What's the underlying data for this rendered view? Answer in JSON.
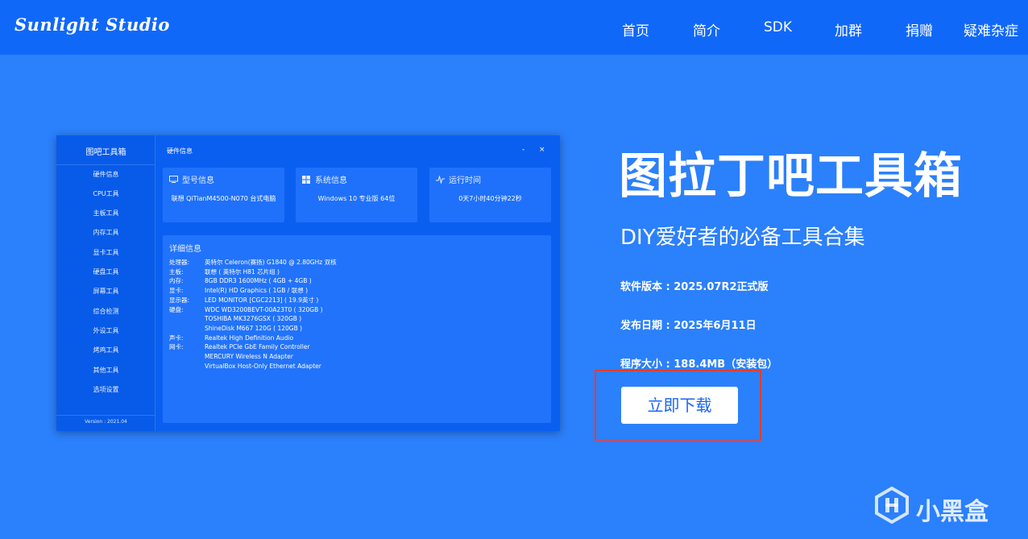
{
  "header": {
    "logo": "Sunlight Studio",
    "nav": [
      "首页",
      "简介",
      "SDK",
      "加群",
      "捐赠",
      "疑难杂症"
    ]
  },
  "app": {
    "sidebar_title": "图吧工具箱",
    "sidebar_items": [
      "硬件信息",
      "CPU工具",
      "主板工具",
      "内存工具",
      "显卡工具",
      "硬盘工具",
      "屏幕工具",
      "综合检测",
      "外设工具",
      "烤鸡工具",
      "其他工具",
      "选项设置"
    ],
    "version": "Version : 2021.04",
    "window_title": "硬件信息",
    "minimize": "-",
    "close": "×",
    "cards": [
      {
        "title": "型号信息",
        "value": "联想 QiTianM4500-N070 台式电脑",
        "icon": "monitor-icon"
      },
      {
        "title": "系统信息",
        "value": "Windows 10 专业版 64位",
        "icon": "windows-icon"
      },
      {
        "title": "运行时间",
        "value": "0天7小时40分钟22秒",
        "icon": "pulse-icon"
      }
    ],
    "details_title": "详细信息",
    "details": [
      {
        "k": "处理器:",
        "v": "英特尔 Celeron(赛扬) G1840 @ 2.80GHz 双核"
      },
      {
        "k": "主板:",
        "v": "联想 ( 英特尔 H81 芯片组 )"
      },
      {
        "k": "内存:",
        "v": "8GB DDR3 1600MHz ( 4GB + 4GB )"
      },
      {
        "k": "显卡:",
        "v": "Intel(R) HD Graphics ( 1GB / 联想 )"
      },
      {
        "k": "显示器:",
        "v": "LED MONITOR [CGC2213] ( 19.9英寸 )"
      },
      {
        "k": "硬盘:",
        "v": "WDC WD3200BEVT-00A23T0 ( 320GB )"
      },
      {
        "k": "",
        "v": "TOSHIBA MK3276GSX ( 320GB )"
      },
      {
        "k": "",
        "v": "ShineDisk M667 120G ( 120GB )"
      },
      {
        "k": "声卡:",
        "v": "Realtek High Definition Audio"
      },
      {
        "k": "网卡:",
        "v": "Realtek PCIe GbE Family Controller"
      },
      {
        "k": "",
        "v": "MERCURY Wireless N Adapter"
      },
      {
        "k": "",
        "v": "VirtualBox Host-Only Ethernet Adapter"
      }
    ]
  },
  "hero": {
    "title": "图拉丁吧工具箱",
    "subtitle": "DIY爱好者的必备工具合集",
    "version": "软件版本 : 2025.07R2正式版",
    "date": "发布日期 : 2025年6月11日",
    "size": "程序大小 : 188.4MB（安装包）",
    "download": "立即下载"
  },
  "watermark": "小黑盒",
  "colors": {
    "page_bg": "#2b80fb",
    "header_bg": "#1068f9",
    "highlight": "#ff3b30"
  }
}
